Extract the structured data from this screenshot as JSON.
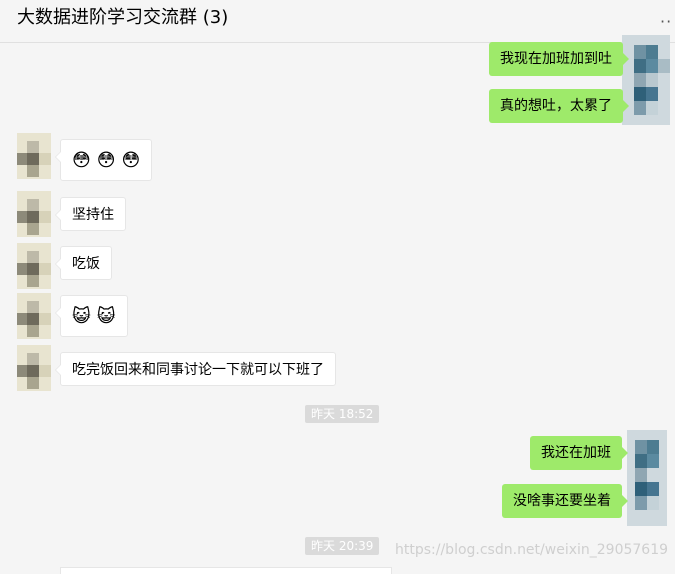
{
  "header": {
    "title": "大数据进阶学习交流群 (3)",
    "more_icon": "more-dots-icon"
  },
  "messages": [
    {
      "sender": "me",
      "text": "我现在加班加到吐"
    },
    {
      "sender": "me",
      "text": "真的想吐，太累了"
    },
    {
      "sender": "other",
      "type": "emoji",
      "emojis": [
        "😳",
        "😳",
        "😳"
      ]
    },
    {
      "sender": "other",
      "text": "坚持住"
    },
    {
      "sender": "other",
      "text": "吃饭"
    },
    {
      "sender": "other",
      "type": "emoji",
      "emojis": [
        "😺",
        "😺"
      ]
    },
    {
      "sender": "other",
      "text": "吃完饭回来和同事讨论一下就可以下班了"
    },
    {
      "sender": "me",
      "text": "我还在加班"
    },
    {
      "sender": "me",
      "text": "没啥事还要坐着"
    }
  ],
  "timestamps": [
    "昨天 18:52",
    "昨天 20:39"
  ],
  "watermark": "https://blog.csdn.net/weixin_29057619",
  "colors": {
    "my_bubble": "#9eea6a",
    "other_bubble": "#ffffff",
    "background": "#f5f5f5"
  }
}
